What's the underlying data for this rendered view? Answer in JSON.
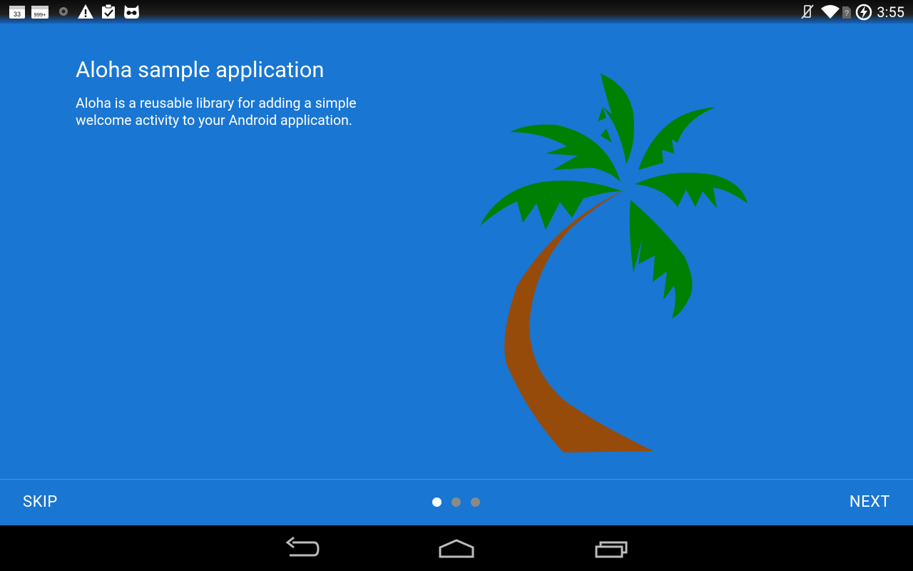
{
  "status_bar": {
    "time": "3:55",
    "badges": {
      "calendar": "33",
      "counter": "999+"
    },
    "left_icons": [
      "calendar-icon",
      "counter-icon",
      "gear-icon",
      "warning-icon",
      "clipboard-check-icon",
      "cyanogen-mascot-icon"
    ],
    "right_icons": [
      "vibrate-off-icon",
      "wifi-icon",
      "sim-unknown-icon",
      "battery-charging-icon"
    ]
  },
  "welcome": {
    "title": "Aloha sample application",
    "description": "Aloha is a reusable library for adding a simple welcome activity to your Android application.",
    "illustration": "palm-tree-icon"
  },
  "pager": {
    "skip_label": "SKIP",
    "next_label": "NEXT",
    "page_count": 3,
    "current_page": 1
  },
  "navigation_bar": {
    "icons": [
      "back-icon",
      "home-icon",
      "recents-icon"
    ]
  },
  "colors": {
    "background": "#1976D2",
    "dot_active": "#FFFFFF",
    "dot_inactive": "#8A8A8A",
    "palm_leaves": "#008000",
    "palm_trunk": "#964B0B"
  }
}
